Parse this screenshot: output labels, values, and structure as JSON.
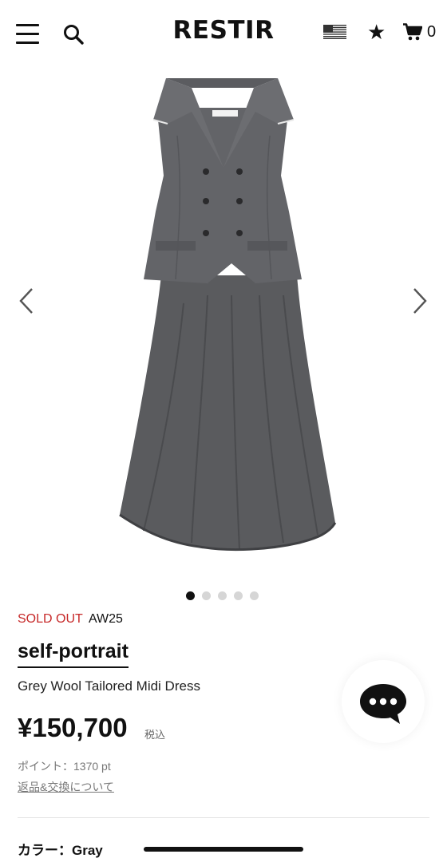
{
  "header": {
    "logo": "RESTIR",
    "cart_count": "0",
    "icons": [
      "hamburger-menu-icon",
      "search-icon",
      "us-flag-icon",
      "star-icon",
      "cart-icon"
    ]
  },
  "carousel": {
    "image_alt": "Grey sleeveless double-breasted tailored top and midi skirt",
    "dot_count": 5,
    "active_index": 0
  },
  "product": {
    "status": "SOLD OUT",
    "season": "AW25",
    "brand": "self-portrait",
    "name": "Grey Wool Tailored Midi Dress",
    "price": "¥150,700",
    "tax_note": "税込",
    "points": "ポイント：1370 pt",
    "return_link": "返品&交換について",
    "color_line": "カラー：Gray"
  },
  "colors": {
    "sold_out": "#c62828",
    "text": "#111111",
    "muted": "#777777",
    "dot_inactive": "#d6d6d6"
  }
}
